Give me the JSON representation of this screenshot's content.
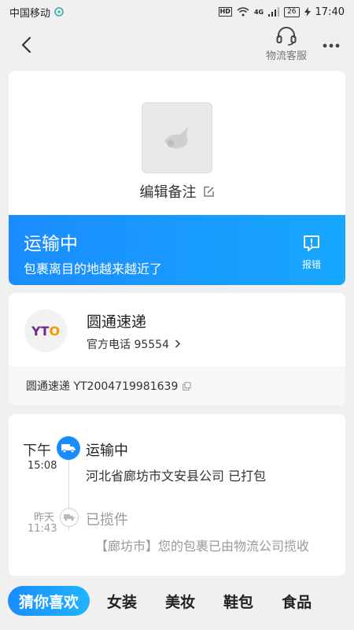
{
  "status_bar": {
    "carrier": "中国移动",
    "hd": "HD",
    "network": "4G",
    "battery": "26",
    "time": "17:40"
  },
  "nav": {
    "back_icon": "chevron-left-icon",
    "customer_service_label": "物流客服",
    "more_icon": "more-icon"
  },
  "package": {
    "edit_remark_label": "编辑备注",
    "status_title": "运输中",
    "status_subtitle": "包裹离目的地越来越近了",
    "report_label": "报错"
  },
  "courier": {
    "logo_text_main": "YT",
    "logo_text_accent": "O",
    "name": "圆通速递",
    "phone_label": "官方电话 95554",
    "tracking_text": "圆通速递 YT2004719981639"
  },
  "timeline": [
    {
      "day": "下午",
      "time": "15:08",
      "title": "运输中",
      "description": "河北省廊坊市文安县公司 已打包",
      "active": true
    },
    {
      "day": "昨天",
      "time": "11:43",
      "title": "已揽件",
      "description": "【廊坊市】您的包裹已由物流公司揽收",
      "active": false
    }
  ],
  "tabs": [
    {
      "label": "猜你喜欢",
      "active": true
    },
    {
      "label": "女装",
      "active": false
    },
    {
      "label": "美妆",
      "active": false
    },
    {
      "label": "鞋包",
      "active": false
    },
    {
      "label": "食品",
      "active": false
    }
  ],
  "colors": {
    "accent": "#1a8cff",
    "background": "#f0f0f0"
  }
}
